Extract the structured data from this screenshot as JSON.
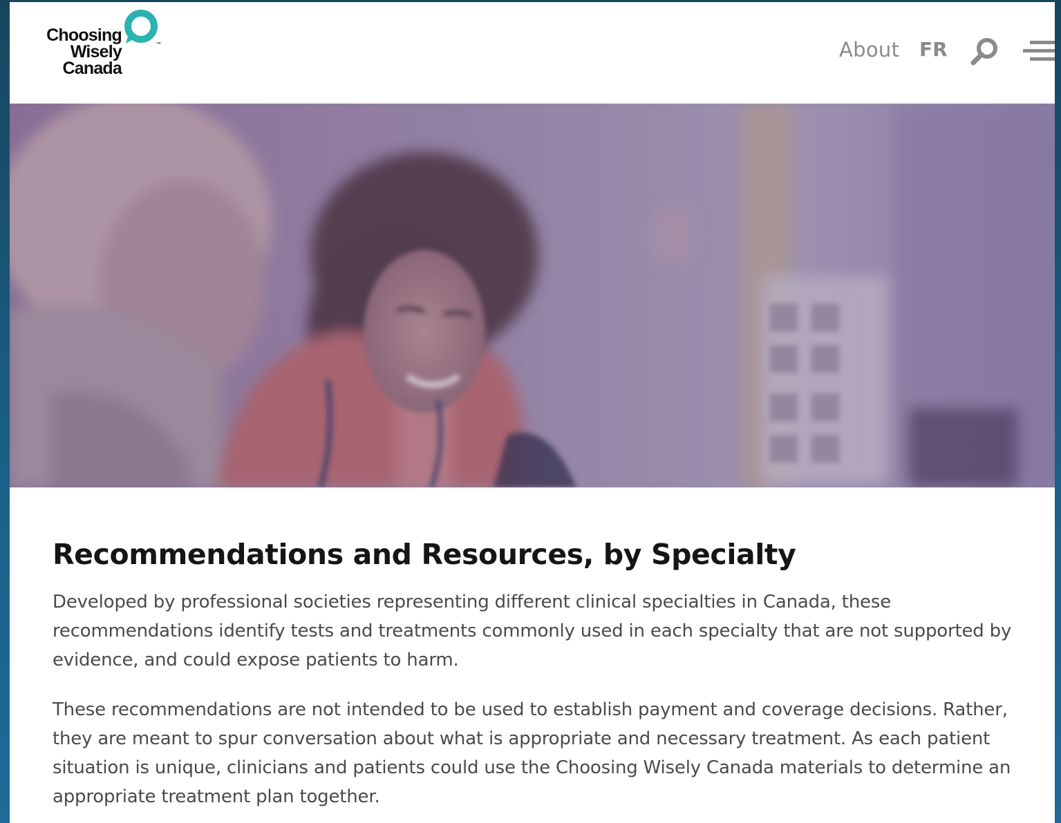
{
  "header": {
    "logo": {
      "line1": "Choosing",
      "line2": "Wisely",
      "line3": "Canada",
      "tm": "™",
      "accent_color": "#2bb3b1"
    },
    "nav": {
      "about_label": "About",
      "language_label": "FR",
      "search_icon": "search-icon",
      "menu_icon": "hamburger-menu-icon"
    }
  },
  "hero": {
    "overlay_color": "#7a6a9a"
  },
  "main": {
    "title": "Recommendations and Resources, by Specialty",
    "paragraphs": [
      "Developed by professional societies representing different clinical specialties in Canada, these recommendations identify tests and treatments commonly used in each specialty that are not supported by evidence, and could expose patients to harm.",
      "These recommendations are not intended to be used to establish payment and coverage decisions. Rather, they are meant to spur conversation about what is appropriate and necessary treatment. As each patient situation is unique, clinicians and patients could use the Choosing Wisely Canada materials to determine an appropriate treatment plan together."
    ]
  }
}
